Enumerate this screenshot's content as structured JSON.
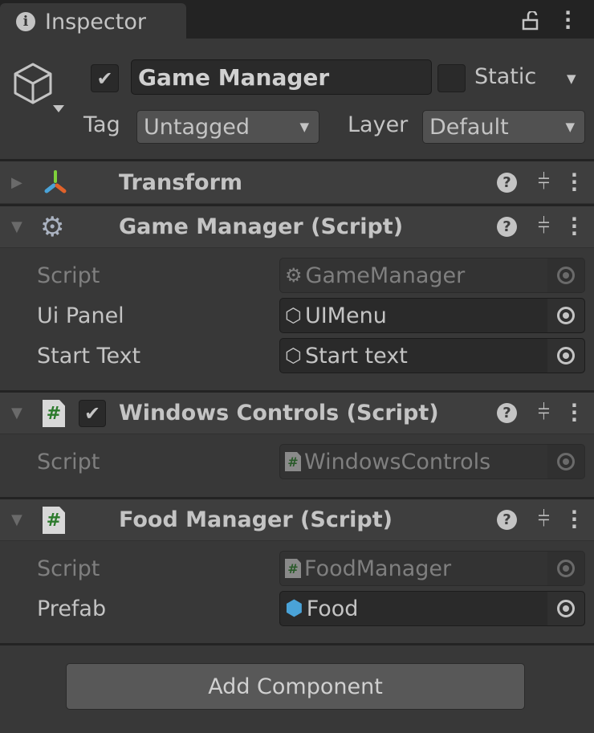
{
  "tab": {
    "title": "Inspector",
    "icon": "info-icon"
  },
  "object": {
    "active": true,
    "name": "Game Manager",
    "static_label": "Static",
    "static": false,
    "tag_label": "Tag",
    "tag": "Untagged",
    "layer_label": "Layer",
    "layer": "Default"
  },
  "components": [
    {
      "title": "Transform",
      "expanded": false,
      "icon": "transform-icon"
    },
    {
      "title": "Game Manager (Script)",
      "expanded": true,
      "icon": "gear-script-icon",
      "fields": [
        {
          "label": "Script",
          "value": "GameManager"
        },
        {
          "label": "Ui Panel",
          "value": "UIMenu"
        },
        {
          "label": "Start Text",
          "value": "Start text"
        }
      ]
    },
    {
      "title": "Windows Controls (Script)",
      "expanded": true,
      "enabled": true,
      "icon": "csharp-script-icon",
      "fields": [
        {
          "label": "Script",
          "value": "WindowsControls"
        }
      ]
    },
    {
      "title": "Food Manager (Script)",
      "expanded": true,
      "icon": "csharp-script-icon",
      "fields": [
        {
          "label": "Script",
          "value": "FoodManager"
        },
        {
          "label": "Prefab",
          "value": "Food"
        }
      ]
    }
  ],
  "add_component": "Add Component",
  "colors": {
    "background": "#383838",
    "header": "#3e3e3e",
    "field": "#2a2a2a",
    "text": "#c4c4c4",
    "prefab_blue": "#4aa3d8"
  }
}
